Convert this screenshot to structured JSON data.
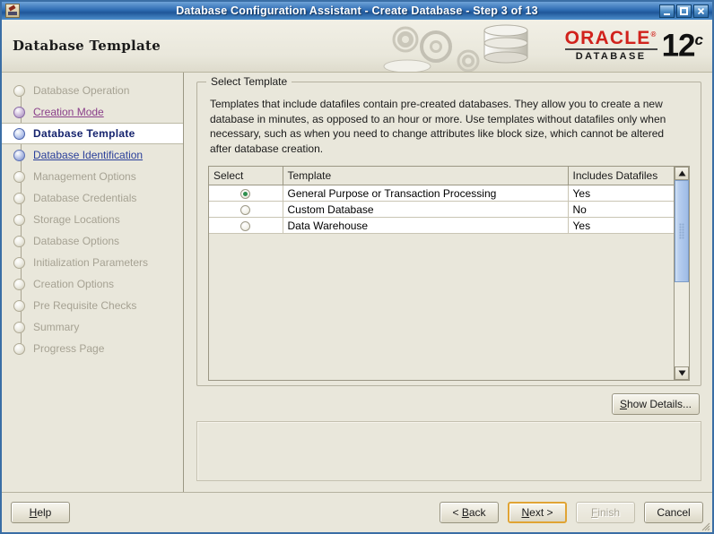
{
  "window": {
    "title": "Database Configuration Assistant - Create Database - Step 3 of 13",
    "icon": "oracle-java-app-icon",
    "minimize_label": "minimize-icon",
    "maximize_label": "maximize-icon",
    "close_label": "close-icon",
    "accent_title_color": "#2f6db4",
    "background_color": "#e9e7db"
  },
  "header": {
    "title": "Database Template",
    "brand": {
      "name": "ORACLE",
      "trademark": "®",
      "product": "DATABASE",
      "version": "12",
      "version_suffix": "c",
      "brand_color": "#d1221c"
    }
  },
  "sidebar": {
    "items": [
      {
        "label": "Database Operation",
        "state": "pending"
      },
      {
        "label": "Creation Mode",
        "state": "done"
      },
      {
        "label": "Database Template",
        "state": "active"
      },
      {
        "label": "Database Identification",
        "state": "visited"
      },
      {
        "label": "Management Options",
        "state": "pending"
      },
      {
        "label": "Database Credentials",
        "state": "pending"
      },
      {
        "label": "Storage Locations",
        "state": "pending"
      },
      {
        "label": "Database Options",
        "state": "pending"
      },
      {
        "label": "Initialization Parameters",
        "state": "pending"
      },
      {
        "label": "Creation Options",
        "state": "pending"
      },
      {
        "label": "Pre Requisite Checks",
        "state": "pending"
      },
      {
        "label": "Summary",
        "state": "pending"
      },
      {
        "label": "Progress Page",
        "state": "pending"
      }
    ]
  },
  "main": {
    "groupbox_legend": "Select Template",
    "description": "Templates that include datafiles contain pre-created databases. They allow you to create a new database in minutes, as opposed to an hour or more. Use templates without datafiles only when necessary, such as when you need to change attributes like block size, which cannot be altered after database creation.",
    "table": {
      "columns": [
        "Select",
        "Template",
        "Includes Datafiles"
      ],
      "rows": [
        {
          "selected": true,
          "template": "General Purpose or Transaction Processing",
          "includes_datafiles": "Yes"
        },
        {
          "selected": false,
          "template": "Custom Database",
          "includes_datafiles": "No"
        },
        {
          "selected": false,
          "template": "Data Warehouse",
          "includes_datafiles": "Yes"
        }
      ]
    },
    "show_details_label": "Show Details...",
    "message_panel_text": ""
  },
  "footer": {
    "help_label": "Help",
    "back_label": "< Back",
    "next_label": "Next >",
    "finish_label": "Finish",
    "cancel_label": "Cancel",
    "next_focused": true,
    "finish_disabled": true,
    "focus_color": "#e0a434"
  }
}
